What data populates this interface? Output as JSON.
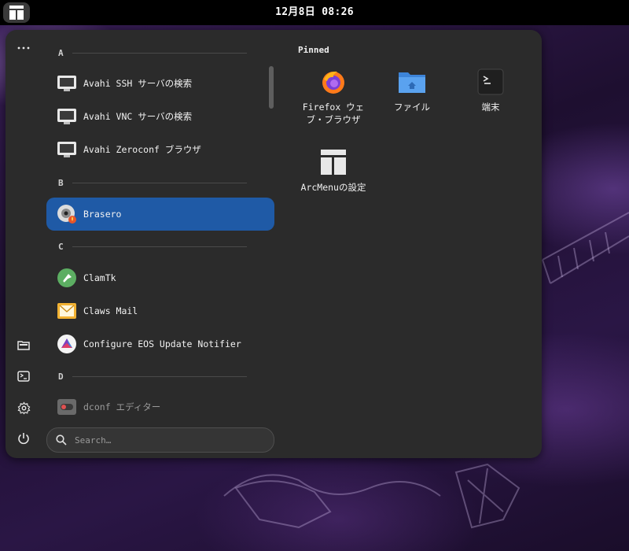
{
  "topbar": {
    "menu_icon": "arcmenu-layout-icon",
    "clock": "12月8日 08:26"
  },
  "sidebar": {
    "icons": [
      {
        "name": "more-options-icon"
      },
      {
        "name": "file-manager-icon"
      },
      {
        "name": "terminal-icon"
      },
      {
        "name": "settings-gear-icon"
      },
      {
        "name": "power-icon"
      }
    ]
  },
  "apps": {
    "sections": [
      {
        "letter": "A",
        "items": [
          "Avahi SSH サーバの検索",
          "Avahi VNC サーバの検索",
          "Avahi Zeroconf ブラウザ"
        ]
      },
      {
        "letter": "B",
        "items": [
          "Brasero"
        ]
      },
      {
        "letter": "C",
        "items": [
          "ClamTk",
          "Claws Mail",
          "Configure EOS Update Notifier"
        ]
      },
      {
        "letter": "D",
        "items": [
          "dconf エディター"
        ]
      }
    ]
  },
  "search": {
    "placeholder": "Search…"
  },
  "pinned": {
    "title": "Pinned",
    "items": [
      {
        "label": "Firefox ウェブ・ブラウザ",
        "icon": "firefox-icon"
      },
      {
        "label": "ファイル",
        "icon": "files-folder-icon"
      },
      {
        "label": "端末",
        "icon": "terminal-icon"
      },
      {
        "label": "ArcMenuの設定",
        "icon": "arcmenu-settings-icon"
      }
    ]
  },
  "colors": {
    "selected": "#1f5aa6",
    "panel": "#2b2b2b",
    "topbar": "#000000"
  }
}
